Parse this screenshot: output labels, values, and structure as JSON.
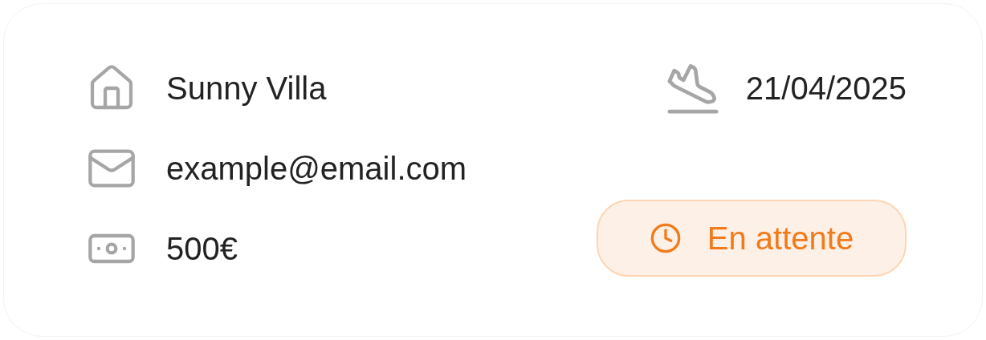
{
  "details": [
    {
      "kind": "property",
      "text": "Sunny Villa"
    },
    {
      "kind": "email",
      "text": "example@email.com"
    },
    {
      "kind": "price",
      "text": "500€"
    }
  ],
  "arrival": {
    "date": "21/04/2025"
  },
  "status": {
    "kind": "pending",
    "label": "En attente"
  }
}
